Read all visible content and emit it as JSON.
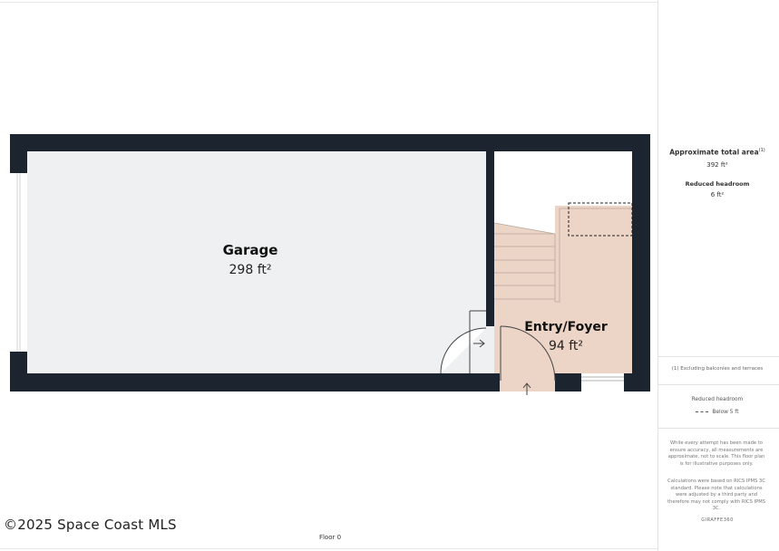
{
  "rooms": {
    "garage": {
      "name": "Garage",
      "area": "298 ft²"
    },
    "entry": {
      "name": "Entry/Foyer",
      "area": "94 ft²"
    }
  },
  "sidebar": {
    "total_label": "Approximate total area",
    "total_mark": "(1)",
    "total_value": "392 ft²",
    "reduced_label": "Reduced headroom",
    "reduced_value": "6 ft²",
    "excluding_note": "(1) Excluding balconies and terraces",
    "legend_title": "Reduced headroom",
    "legend_item": "Below 5 ft",
    "disclaimer_1": "While every attempt has been made to ensure accuracy, all measurements are approximate, not to scale. This floor plan is for illustrative purposes only.",
    "disclaimer_2": "Calculations were based on RICS IPMS 3C standard. Please note that calculations were adjusted by a third party and therefore may not comply with RICS IPMS 3C.",
    "brand": "GIRAFFE360"
  },
  "footer": {
    "copyright": "©2025 Space Coast MLS",
    "floor_label": "Floor 0"
  },
  "colors": {
    "wall": "#1c2430",
    "garage_floor": "#eff0f1",
    "entry_floor": "#ecd4c6",
    "line": "#b9a79c"
  }
}
